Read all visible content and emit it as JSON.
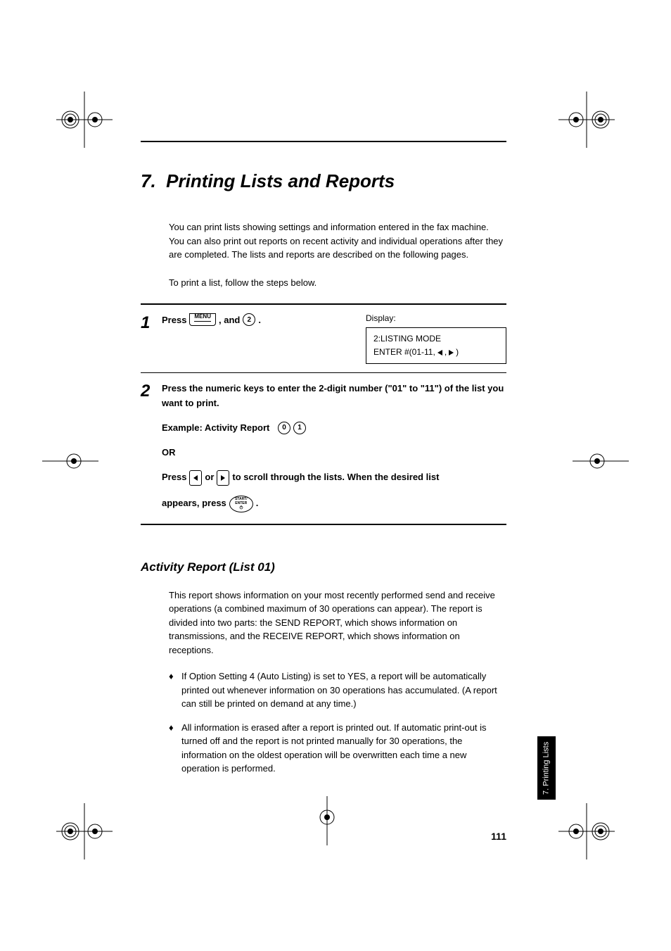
{
  "chapterNumber": "7.",
  "chapterTitle": "Printing Lists and Reports",
  "intro1": "You can print lists showing settings and information entered in the fax machine. You can also print out reports on recent activity and individual operations after they are completed. The lists and reports are described on the following pages.",
  "intro2": "To print a list, follow the steps below.",
  "step1": {
    "num": "1",
    "pressLabel": "Press",
    "menuKey": "MENU",
    "and": ", and",
    "key2": "2",
    "period": ".",
    "displayLabel": "Display:",
    "displayLine1": "2:LISTING MODE",
    "displayLine2a": "ENTER #(01-11,",
    "displayLine2b": ")"
  },
  "step2": {
    "num": "2",
    "line1": "Press the numeric keys to enter the 2-digit number (\"01\" to \"11\") of the list you want to print.",
    "exampleLabel": "Example: Activity Report",
    "key0": "0",
    "key1": "1",
    "or": "OR",
    "pressLabel": "Press",
    "orWord": "or",
    "scrollText": "to scroll through the lists. When the desired list",
    "appearsText": "appears, press",
    "startKey1": "START/",
    "startKey2": "ENTER",
    "period": "."
  },
  "sectionHeading": "Activity Report (List 01)",
  "sectionPara": "This report shows information on your most recently performed send and receive operations (a combined maximum of 30 operations can appear). The report is divided into two parts: the SEND REPORT, which shows information on transmissions, and the RECEIVE REPORT, which shows information on receptions.",
  "bullet1": "If Option Setting 4 (Auto Listing) is set to YES, a report will be automatically printed out whenever information on 30 operations has accumulated. (A report can still be printed on demand at any time.)",
  "bullet2": "All information is erased after a report is printed out. If automatic print-out is turned off and the report is not printed manually for 30 operations, the information on the oldest operation will be overwritten each time a new operation is performed.",
  "pageNumber": "111",
  "sideTab": "7. Printing Lists"
}
